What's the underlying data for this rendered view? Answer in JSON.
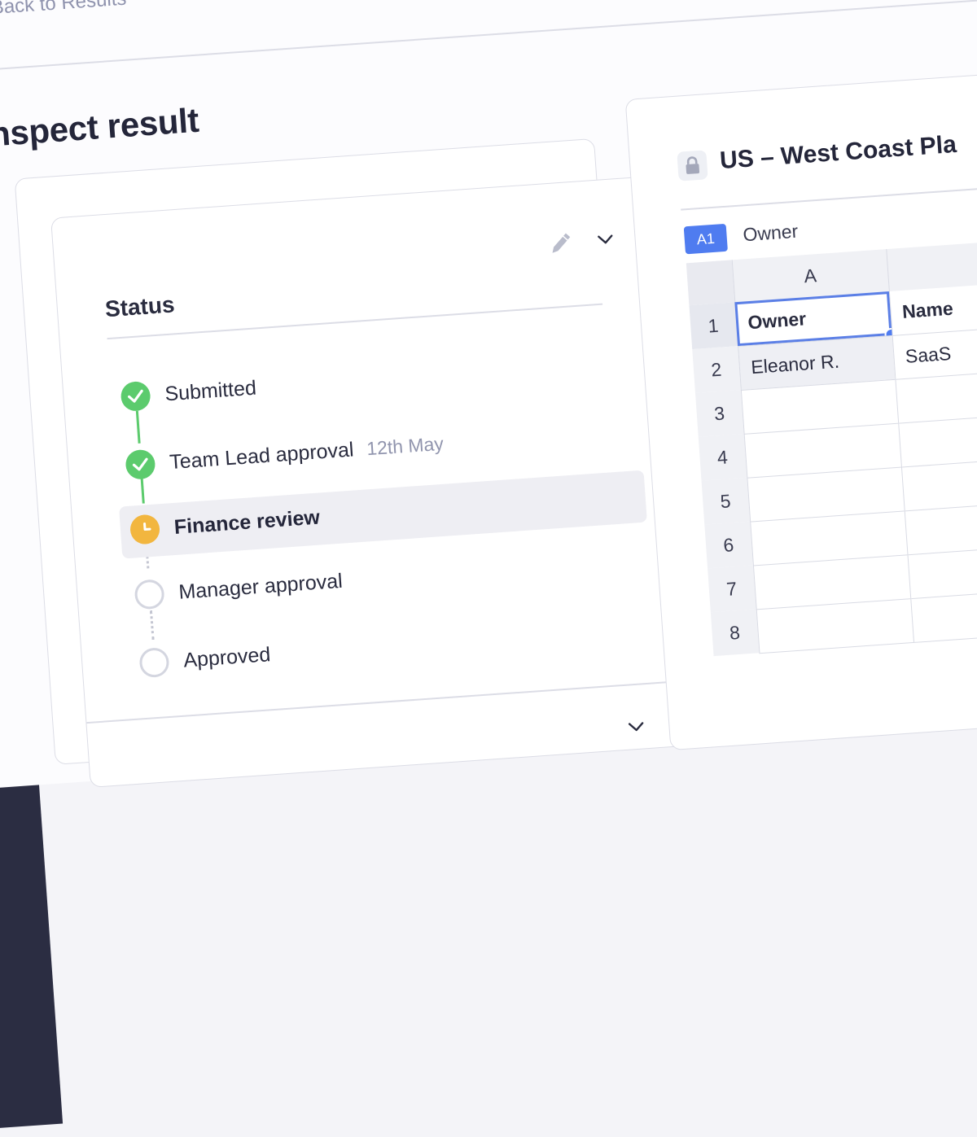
{
  "nav": {
    "back_label": "Back to Results"
  },
  "page": {
    "title": "Inspect result"
  },
  "status_card": {
    "heading": "Status",
    "steps": [
      {
        "label": "Submitted",
        "state": "done",
        "date": ""
      },
      {
        "label": "Team Lead approval",
        "state": "done",
        "date": "12th May"
      },
      {
        "label": "Finance review",
        "state": "current",
        "date": ""
      },
      {
        "label": "Manager approval",
        "state": "pending",
        "date": ""
      },
      {
        "label": "Approved",
        "state": "pending",
        "date": ""
      }
    ]
  },
  "sheet": {
    "title": "US – West Coast Pla",
    "cell_ref": "A1",
    "cell_ref_value": "Owner",
    "columns": [
      "A",
      "Name"
    ],
    "rows": [
      {
        "num": "1",
        "a": "Owner",
        "b": "Name"
      },
      {
        "num": "2",
        "a": "Eleanor R.",
        "b": "SaaS"
      },
      {
        "num": "3",
        "a": "",
        "b": ""
      },
      {
        "num": "4",
        "a": "",
        "b": ""
      },
      {
        "num": "5",
        "a": "",
        "b": ""
      },
      {
        "num": "6",
        "a": "",
        "b": ""
      },
      {
        "num": "7",
        "a": "",
        "b": ""
      },
      {
        "num": "8",
        "a": "",
        "b": ""
      }
    ]
  },
  "colors": {
    "done": "#5ccb6d",
    "current": "#f2b63f",
    "pending_border": "#d4d6e0",
    "accent": "#4f7cf0"
  },
  "icons": {
    "back": "arrow-left-icon",
    "edit": "pencil-icon",
    "expand": "chevron-down-icon",
    "lock": "lock-icon",
    "done": "check-icon",
    "current": "clock-icon"
  }
}
